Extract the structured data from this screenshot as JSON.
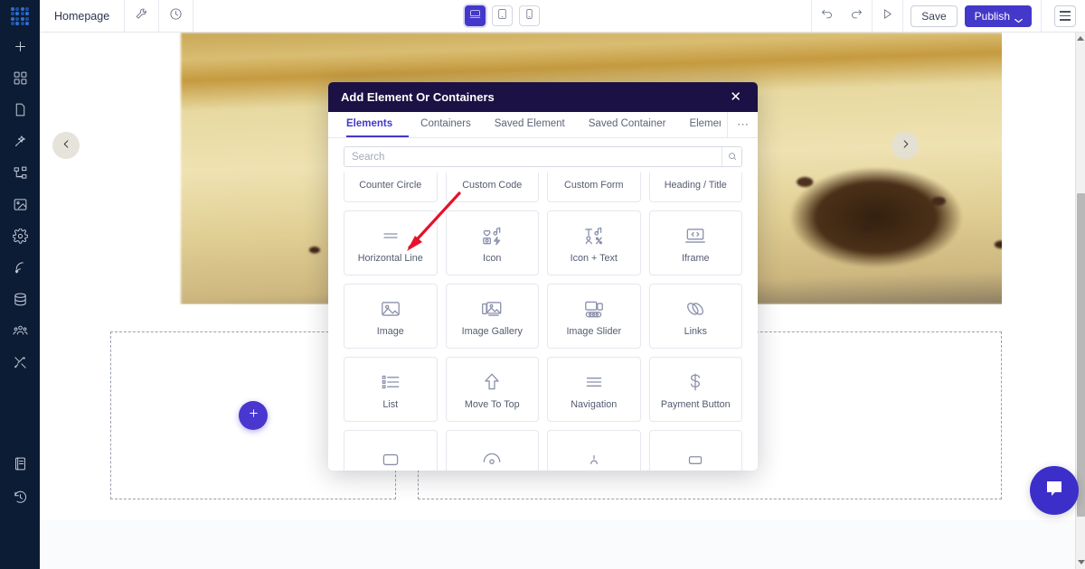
{
  "app": {
    "logo_icon": "dots-grid-logo"
  },
  "topbar": {
    "page_name": "Homepage",
    "settings_icon": "wrench-icon",
    "history_icon": "clock-icon",
    "devices": [
      {
        "name": "desktop",
        "icon": "desktop-icon",
        "active": true
      },
      {
        "name": "tablet",
        "icon": "tablet-icon",
        "active": false
      },
      {
        "name": "mobile",
        "icon": "mobile-icon",
        "active": false
      }
    ],
    "undo_icon": "undo-icon",
    "redo_icon": "redo-icon",
    "preview_icon": "play-icon",
    "save_label": "Save",
    "publish_label": "Publish",
    "menu_icon": "hamburger-icon"
  },
  "sidebar": {
    "items": [
      {
        "name": "add",
        "icon": "plus-icon"
      },
      {
        "name": "widgets",
        "icon": "grid-icon"
      },
      {
        "name": "pages",
        "icon": "page-icon"
      },
      {
        "name": "design",
        "icon": "magic-wand-icon"
      },
      {
        "name": "layers",
        "icon": "sitemap-icon"
      },
      {
        "name": "media",
        "icon": "image-icon"
      },
      {
        "name": "settings",
        "icon": "gear-icon"
      },
      {
        "name": "marketing",
        "icon": "broadcast-icon"
      },
      {
        "name": "database",
        "icon": "database-icon"
      },
      {
        "name": "team",
        "icon": "users-icon"
      },
      {
        "name": "tools",
        "icon": "tools-icon"
      }
    ],
    "bottom_items": [
      {
        "name": "docs",
        "icon": "book-icon"
      },
      {
        "name": "revisions",
        "icon": "history-icon"
      }
    ]
  },
  "canvas": {
    "hero": {
      "alt": "coffee beans on burlap",
      "prev_icon": "chevron-left-icon",
      "next_icon": "chevron-right-icon"
    },
    "dropzones": [
      {
        "name": "left-dropzone",
        "add_icon": "plus-icon"
      },
      {
        "name": "right-dropzone"
      }
    ]
  },
  "modal": {
    "title": "Add Element Or Containers",
    "close_icon": "close-icon",
    "tabs": [
      {
        "label": "Elements",
        "active": true
      },
      {
        "label": "Containers",
        "active": false
      },
      {
        "label": "Saved Element",
        "active": false
      },
      {
        "label": "Saved Container",
        "active": false
      },
      {
        "label": "Element S",
        "active": false,
        "clipped": true
      }
    ],
    "tabs_overflow_label": "⋯",
    "search": {
      "placeholder": "Search",
      "value": "",
      "icon": "search-icon"
    },
    "elements": [
      {
        "label": "Counter Circle",
        "icon": "counter-circle-icon",
        "row": 0
      },
      {
        "label": "Custom Code",
        "icon": "custom-code-icon",
        "row": 0
      },
      {
        "label": "Custom Form",
        "icon": "custom-form-icon",
        "row": 0
      },
      {
        "label": "Heading / Title",
        "icon": "heading-icon",
        "row": 0
      },
      {
        "label": "Horizontal Line",
        "icon": "horizontal-line-icon",
        "row": 1
      },
      {
        "label": "Icon",
        "icon": "icon-set-icon",
        "row": 1
      },
      {
        "label": "Icon + Text",
        "icon": "icon-text-icon",
        "row": 1
      },
      {
        "label": "Iframe",
        "icon": "iframe-icon",
        "row": 1
      },
      {
        "label": "Image",
        "icon": "image-icon",
        "row": 2
      },
      {
        "label": "Image Gallery",
        "icon": "image-gallery-icon",
        "row": 2
      },
      {
        "label": "Image Slider",
        "icon": "image-slider-icon",
        "row": 2
      },
      {
        "label": "Links",
        "icon": "links-icon",
        "row": 2
      },
      {
        "label": "List",
        "icon": "list-icon",
        "row": 3
      },
      {
        "label": "Move To Top",
        "icon": "arrow-up-icon",
        "row": 3
      },
      {
        "label": "Navigation",
        "icon": "navigation-icon",
        "row": 3
      },
      {
        "label": "Payment Button",
        "icon": "dollar-icon",
        "row": 3
      },
      {
        "label": "",
        "icon": "partial-icon-1",
        "row": 4
      },
      {
        "label": "",
        "icon": "partial-icon-2",
        "row": 4
      },
      {
        "label": "",
        "icon": "partial-icon-3",
        "row": 4
      },
      {
        "label": "",
        "icon": "partial-icon-4",
        "row": 4
      }
    ],
    "annotation": {
      "name": "red-arrow-pointing-to-image-element",
      "color": "#e8102a"
    }
  },
  "chat": {
    "icon": "chat-bubble-icon"
  },
  "scrollbar": {
    "up_icon": "caret-up-icon",
    "down_icon": "caret-down-icon"
  },
  "colors": {
    "accent": "#4338ca",
    "modal_header": "#1b1144",
    "sidebar": "#0d1c35",
    "annotation_red": "#e8102a",
    "fab_purple": "#4a37cf"
  }
}
